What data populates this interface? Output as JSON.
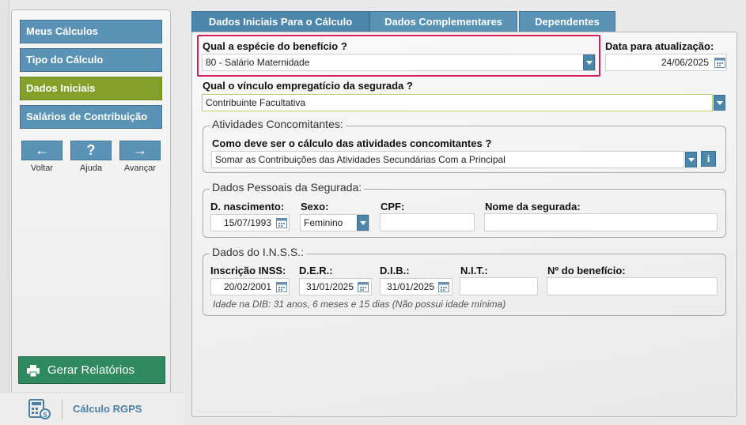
{
  "sidebar": {
    "nav": [
      {
        "label": "Meus Cálculos"
      },
      {
        "label": "Tipo do Cálculo"
      },
      {
        "label": "Dados Iniciais"
      },
      {
        "label": "Salários de Contribuição"
      }
    ],
    "back_label": "Voltar",
    "help_label": "Ajuda",
    "forward_label": "Avançar",
    "back_glyph": "←",
    "help_glyph": "?",
    "forward_glyph": "→",
    "report_button": "Gerar Relatórios",
    "app_name": "Cálculo RGPS"
  },
  "tabs": [
    {
      "label": "Dados Iniciais Para o Cálculo"
    },
    {
      "label": "Dados Complementares"
    },
    {
      "label": "Dependentes"
    }
  ],
  "form": {
    "beneficio_label": "Qual a espécie do benefício ?",
    "beneficio_value": "80 - Salário Maternidade",
    "data_atualizacao_label": "Data para atualização:",
    "data_atualizacao_value": "24/06/2025",
    "vinculo_label": "Qual o vínculo empregatício da segurada ?",
    "vinculo_value": "Contribuinte Facultativa"
  },
  "atividades": {
    "legend": "Atividades Concomitantes:",
    "question": "Como deve ser o cálculo das atividades concomitantes ?",
    "value": "Somar as Contribuições das Atividades Secundárias Com a Principal",
    "info": "i"
  },
  "pessoais": {
    "legend": "Dados Pessoais da Segurada:",
    "nascimento_label": "D. nascimento:",
    "nascimento_value": "15/07/1993",
    "sexo_label": "Sexo:",
    "sexo_value": "Feminino",
    "cpf_label": "CPF:",
    "cpf_value": "",
    "nome_label": "Nome da segurada:",
    "nome_value": ""
  },
  "inss": {
    "legend": "Dados do I.N.S.S.:",
    "inscricao_label": "Inscrição INSS:",
    "inscricao_value": "20/02/2001",
    "der_label": "D.E.R.:",
    "der_value": "31/01/2025",
    "dib_label": "D.I.B.:",
    "dib_value": "31/01/2025",
    "nit_label": "N.I.T.:",
    "nit_value": "",
    "beneficio_num_label": "Nº do benefício:",
    "beneficio_num_value": "",
    "note": "Idade na DIB: 31 anos, 6 meses e 15 dias (Não possui idade mínima)"
  },
  "colors": {
    "nav_blue": "#5a93b6",
    "nav_active_green": "#85a02a",
    "report_green": "#2f8a60",
    "highlight_red": "#d61f52"
  }
}
